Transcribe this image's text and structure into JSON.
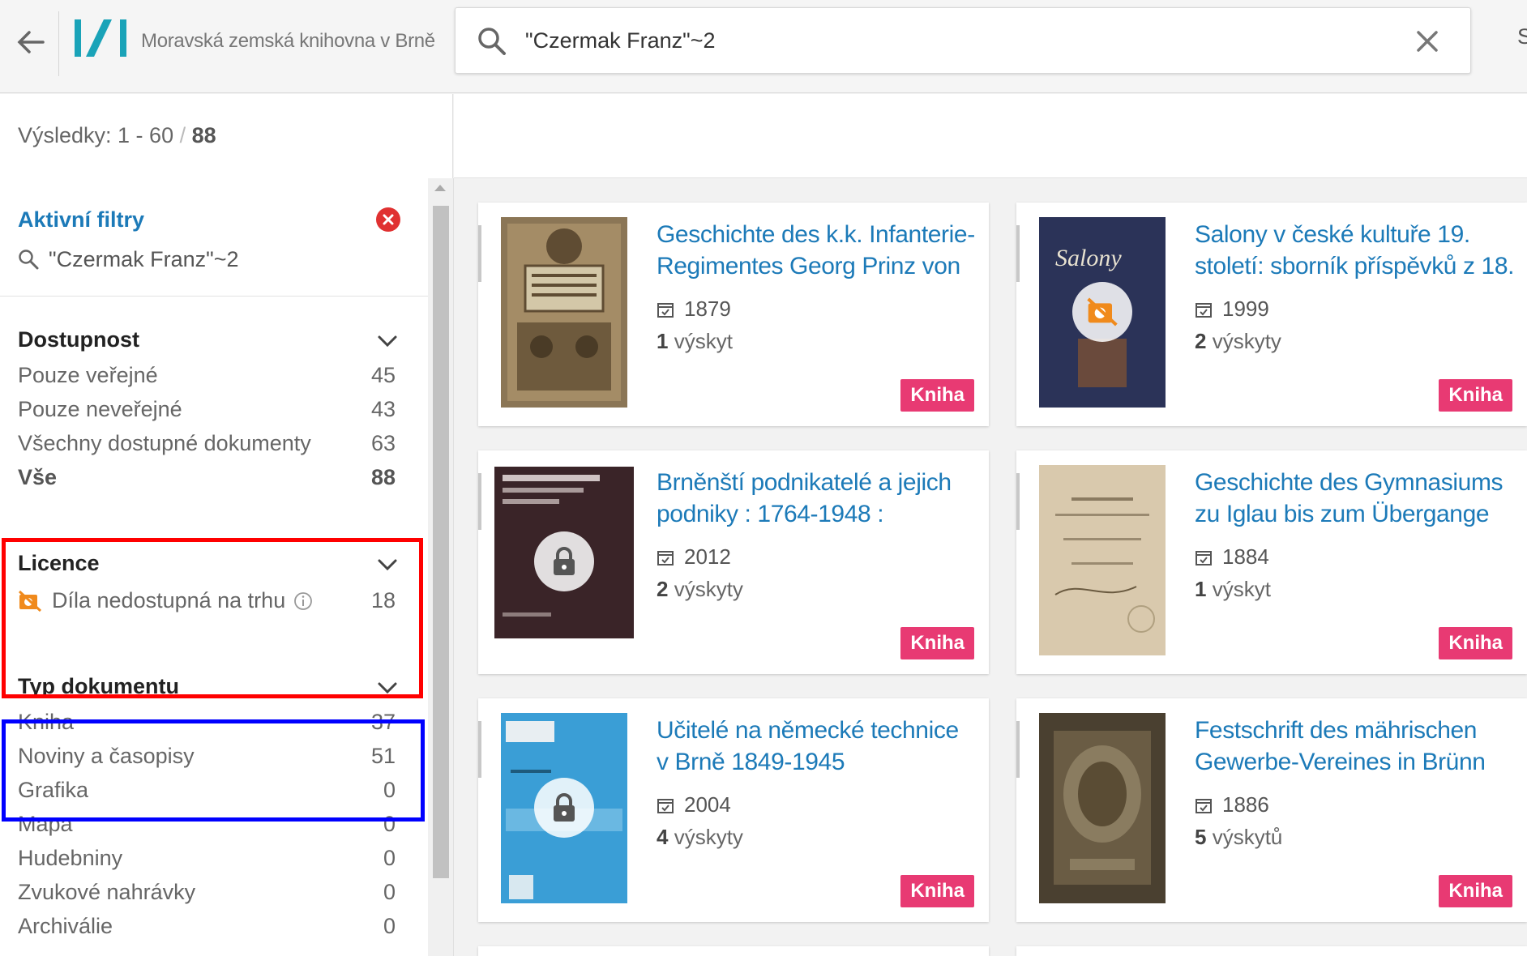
{
  "header": {
    "library_name": "Moravská zemská knihovna v Brně",
    "search_value": "\"Czermak Franz\"~2",
    "cut_text": "S"
  },
  "results": {
    "prefix": "Výsledky: 1 - 60",
    "slash": " / ",
    "total": "88"
  },
  "active_filters": {
    "title": "Aktivní filtry",
    "item": "\"Czermak Franz\"~2"
  },
  "facets": {
    "dostupnost": {
      "title": "Dostupnost",
      "items": [
        {
          "label": "Pouze veřejné",
          "count": "45"
        },
        {
          "label": "Pouze neveřejné",
          "count": "43"
        },
        {
          "label": "Všechny dostupné dokumenty",
          "count": "63"
        },
        {
          "label": "Vše",
          "count": "88"
        }
      ]
    },
    "licence": {
      "title": "Licence",
      "items": [
        {
          "label": "Díla nedostupná na trhu",
          "count": "18"
        }
      ]
    },
    "typ": {
      "title": "Typ dokumentu",
      "items": [
        {
          "label": "Kniha",
          "count": "37"
        },
        {
          "label": "Noviny a časopisy",
          "count": "51"
        },
        {
          "label": "Grafika",
          "count": "0"
        },
        {
          "label": "Mapa",
          "count": "0"
        },
        {
          "label": "Hudebniny",
          "count": "0"
        },
        {
          "label": "Zvukové nahrávky",
          "count": "0"
        },
        {
          "label": "Archiválie",
          "count": "0"
        }
      ]
    }
  },
  "cards": [
    {
      "title": "Geschichte des k.k. Infanterie-Regimentes Georg Prinz von",
      "year": "1879",
      "hits_num": "1",
      "hits_word": "výskyt",
      "badge": "Kniha"
    },
    {
      "title": "Salony v české kultuře 19. století: sborník příspěvků z 18.",
      "year": "1999",
      "hits_num": "2",
      "hits_word": "výskyty",
      "badge": "Kniha"
    },
    {
      "title": "Brněnští podnikatelé a jejich podniky : 1764-1948 :",
      "year": "2012",
      "hits_num": "2",
      "hits_word": "výskyty",
      "badge": "Kniha"
    },
    {
      "title": "Geschichte des Gymnasiums zu Iglau bis zum Übergange",
      "year": "1884",
      "hits_num": "1",
      "hits_word": "výskyt",
      "badge": "Kniha"
    },
    {
      "title": "Učitelé na německé technice v Brně 1849-1945",
      "year": "2004",
      "hits_num": "4",
      "hits_word": "výskyty",
      "badge": "Kniha"
    },
    {
      "title": "Festschrift des mährischen Gewerbe-Vereines in Brünn zur",
      "year": "1886",
      "hits_num": "5",
      "hits_word": "výskytů",
      "badge": "Kniha"
    }
  ],
  "colors": {
    "link": "#1c7ab8",
    "badge": "#e83a73",
    "highlight_red": "#ff0000",
    "highlight_blue": "#0000ff"
  }
}
